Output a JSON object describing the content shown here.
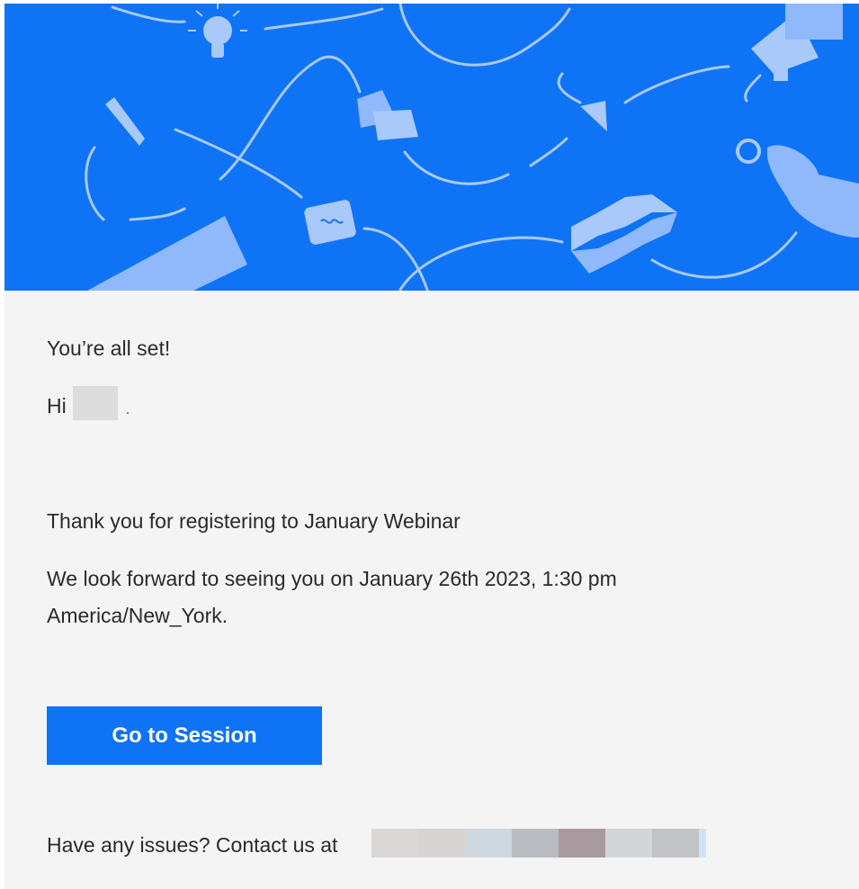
{
  "banner": {
    "background_color": "#0f73f5",
    "illustration_icons": [
      "lightbulb-icon",
      "megaphone-icon",
      "pencil-icon",
      "speech-bubbles-icon",
      "arrow-down-icon",
      "magnifier-hand-icon",
      "chat-card-icon",
      "keyboard-icon",
      "stairs-icon"
    ]
  },
  "message": {
    "heading": "You’re all set!",
    "greeting": "Hi",
    "thanks_text": "Thank you for registering to January Webinar",
    "schedule_text": "We look forward to seeing you on January 26th 2023, 1:30 pm America/New_York."
  },
  "cta": {
    "label": "Go to Session",
    "color": "#0f73f5"
  },
  "contact": {
    "text": "Have any issues? Contact us at"
  },
  "colors": {
    "content_background": "#f4f4f4",
    "text": "#2a2a2a"
  }
}
